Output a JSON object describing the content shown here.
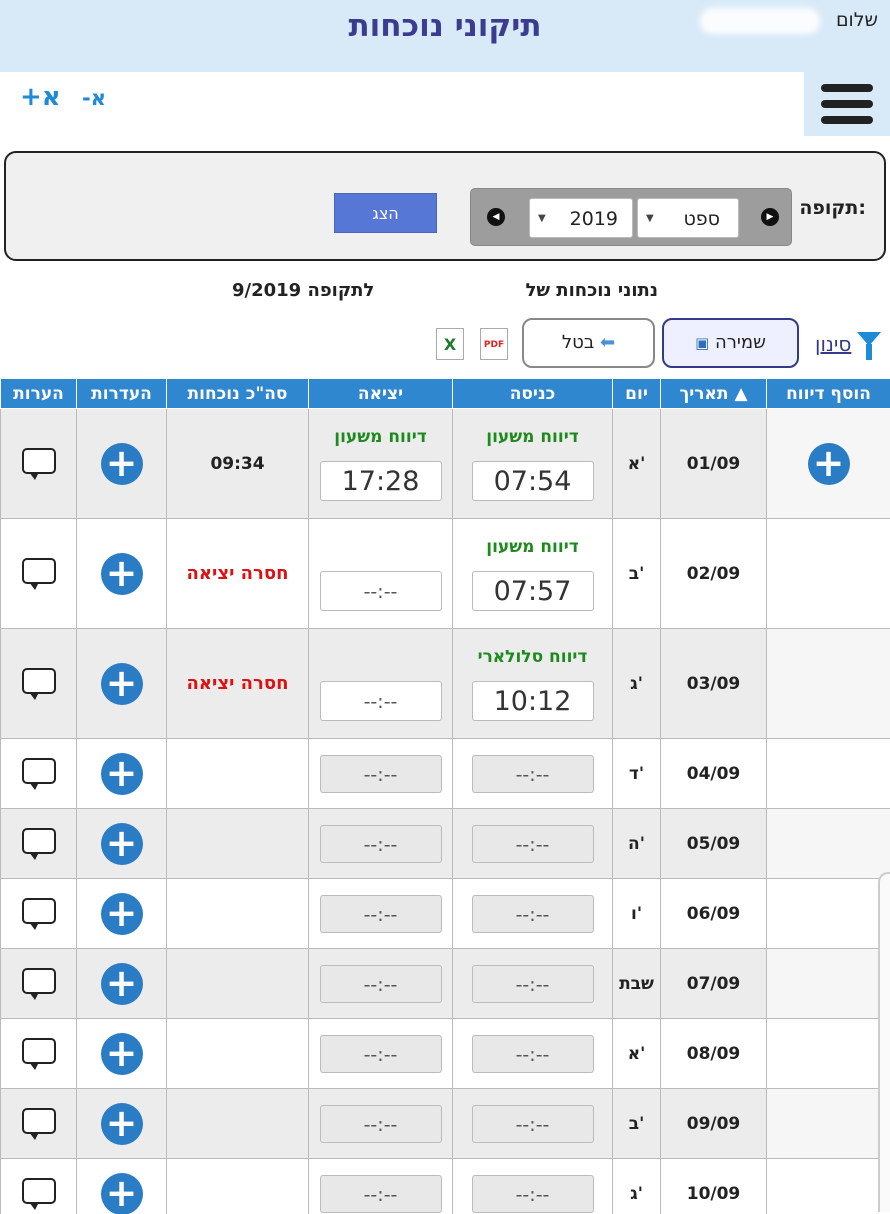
{
  "header": {
    "title": "תיקוני נוכחות",
    "greeting": "שלום",
    "font_increase": "+א",
    "font_decrease": "-א"
  },
  "period": {
    "label": "תקופה:",
    "month": "ספט",
    "year": "2019",
    "show_button": "הצג"
  },
  "info": {
    "attendance_of": "נתוני נוכחות של",
    "period_text": "לתקופה 9/2019"
  },
  "toolbar": {
    "save_label": "שמירה",
    "cancel_label": "בטל",
    "filter_label": "סינון",
    "pdf_label": "PDF",
    "excel_label": "X"
  },
  "table": {
    "columns": {
      "add_report": "הוסף דיווח",
      "date": "תאריך ▲",
      "day": "יום",
      "entry": "כניסה",
      "exit": "יציאה",
      "total": "סה\"כ נוכחות",
      "absences": "העדרות",
      "notes": "הערות"
    },
    "rows": [
      {
        "date": "01/09",
        "day": "א'",
        "entry_type": "דיווח משעון",
        "entry": "07:54",
        "exit_type": "דיווח משעון",
        "exit": "17:28",
        "total": "09:34"
      },
      {
        "date": "02/09",
        "day": "ב'",
        "entry_type": "דיווח משעון",
        "entry": "07:57",
        "exit": "--:--",
        "total": "חסרה יציאה"
      },
      {
        "date": "03/09",
        "day": "ג'",
        "entry_type": "דיווח סלולארי",
        "entry": "10:12",
        "exit": "--:--",
        "total": "חסרה יציאה"
      },
      {
        "date": "04/09",
        "day": "ד'",
        "entry": "--:--",
        "exit": "--:--"
      },
      {
        "date": "05/09",
        "day": "ה'",
        "entry": "--:--",
        "exit": "--:--"
      },
      {
        "date": "06/09",
        "day": "ו'",
        "entry": "--:--",
        "exit": "--:--"
      },
      {
        "date": "07/09",
        "day": "שבת",
        "entry": "--:--",
        "exit": "--:--"
      },
      {
        "date": "08/09",
        "day": "א'",
        "entry": "--:--",
        "exit": "--:--"
      },
      {
        "date": "09/09",
        "day": "ב'",
        "entry": "--:--",
        "exit": "--:--"
      },
      {
        "date": "10/09",
        "day": "ג'",
        "entry": "--:--",
        "exit": "--:--"
      }
    ]
  }
}
